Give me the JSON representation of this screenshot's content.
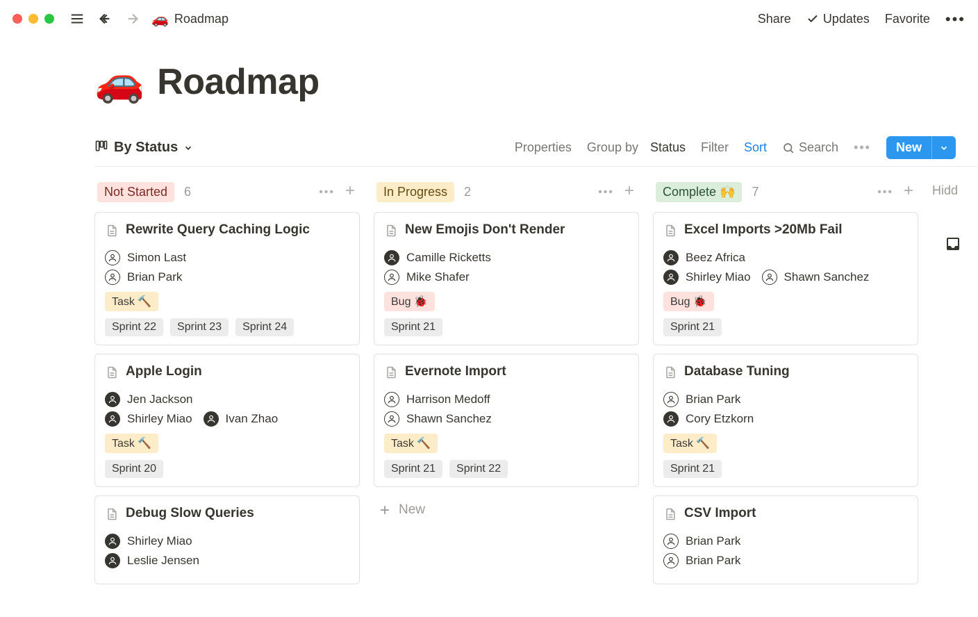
{
  "topbar": {
    "breadcrumb_emoji": "🚗",
    "breadcrumb_title": "Roadmap",
    "share": "Share",
    "updates": "Updates",
    "favorite": "Favorite"
  },
  "page": {
    "emoji": "🚗",
    "title": "Roadmap"
  },
  "view": {
    "name": "By Status"
  },
  "controls": {
    "properties": "Properties",
    "group_by_label": "Group by",
    "group_by_value": "Status",
    "filter": "Filter",
    "sort": "Sort",
    "search": "Search",
    "new": "New"
  },
  "board": {
    "hidden_label": "Hidd",
    "columns": [
      {
        "status": "Not Started",
        "pill": "red",
        "count": 6,
        "cards": [
          {
            "title": "Rewrite Query Caching Logic",
            "people": [
              [
                {
                  "name": "Simon Last",
                  "style": "line"
                }
              ],
              [
                {
                  "name": "Brian Park",
                  "style": "line"
                }
              ]
            ],
            "type": {
              "label": "Task 🔨",
              "kind": "task"
            },
            "sprints": [
              "Sprint 22",
              "Sprint 23",
              "Sprint 24"
            ]
          },
          {
            "title": "Apple Login",
            "people": [
              [
                {
                  "name": "Jen Jackson",
                  "style": "filled"
                }
              ],
              [
                {
                  "name": "Shirley Miao",
                  "style": "filled"
                },
                {
                  "name": "Ivan Zhao",
                  "style": "filled"
                }
              ]
            ],
            "type": {
              "label": "Task 🔨",
              "kind": "task"
            },
            "sprints": [
              "Sprint 20"
            ]
          },
          {
            "title": "Debug Slow Queries",
            "people": [
              [
                {
                  "name": "Shirley Miao",
                  "style": "filled"
                }
              ],
              [
                {
                  "name": "Leslie Jensen",
                  "style": "filled"
                }
              ]
            ],
            "type": null,
            "sprints": []
          }
        ],
        "show_new": false
      },
      {
        "status": "In Progress",
        "pill": "yellow",
        "count": 2,
        "cards": [
          {
            "title": "New Emojis Don't Render",
            "people": [
              [
                {
                  "name": "Camille Ricketts",
                  "style": "filled"
                }
              ],
              [
                {
                  "name": "Mike Shafer",
                  "style": "line"
                }
              ]
            ],
            "type": {
              "label": "Bug 🐞",
              "kind": "bug"
            },
            "sprints": [
              "Sprint 21"
            ]
          },
          {
            "title": "Evernote Import",
            "people": [
              [
                {
                  "name": "Harrison Medoff",
                  "style": "line"
                }
              ],
              [
                {
                  "name": "Shawn Sanchez",
                  "style": "line"
                }
              ]
            ],
            "type": {
              "label": "Task 🔨",
              "kind": "task"
            },
            "sprints": [
              "Sprint 21",
              "Sprint 22"
            ]
          }
        ],
        "show_new": true,
        "new_label": "New"
      },
      {
        "status": "Complete 🙌",
        "pill": "green",
        "count": 7,
        "cards": [
          {
            "title": "Excel Imports >20Mb Fail",
            "people": [
              [
                {
                  "name": "Beez Africa",
                  "style": "filled"
                }
              ],
              [
                {
                  "name": "Shirley Miao",
                  "style": "filled"
                },
                {
                  "name": "Shawn Sanchez",
                  "style": "line"
                }
              ]
            ],
            "type": {
              "label": "Bug 🐞",
              "kind": "bug"
            },
            "sprints": [
              "Sprint 21"
            ]
          },
          {
            "title": "Database Tuning",
            "people": [
              [
                {
                  "name": "Brian Park",
                  "style": "line"
                }
              ],
              [
                {
                  "name": "Cory Etzkorn",
                  "style": "filled"
                }
              ]
            ],
            "type": {
              "label": "Task 🔨",
              "kind": "task"
            },
            "sprints": [
              "Sprint 21"
            ]
          },
          {
            "title": "CSV Import",
            "people": [
              [
                {
                  "name": "Brian Park",
                  "style": "line"
                }
              ],
              [
                {
                  "name": "Brian Park",
                  "style": "line"
                }
              ]
            ],
            "type": null,
            "sprints": []
          }
        ],
        "show_new": false
      }
    ]
  }
}
